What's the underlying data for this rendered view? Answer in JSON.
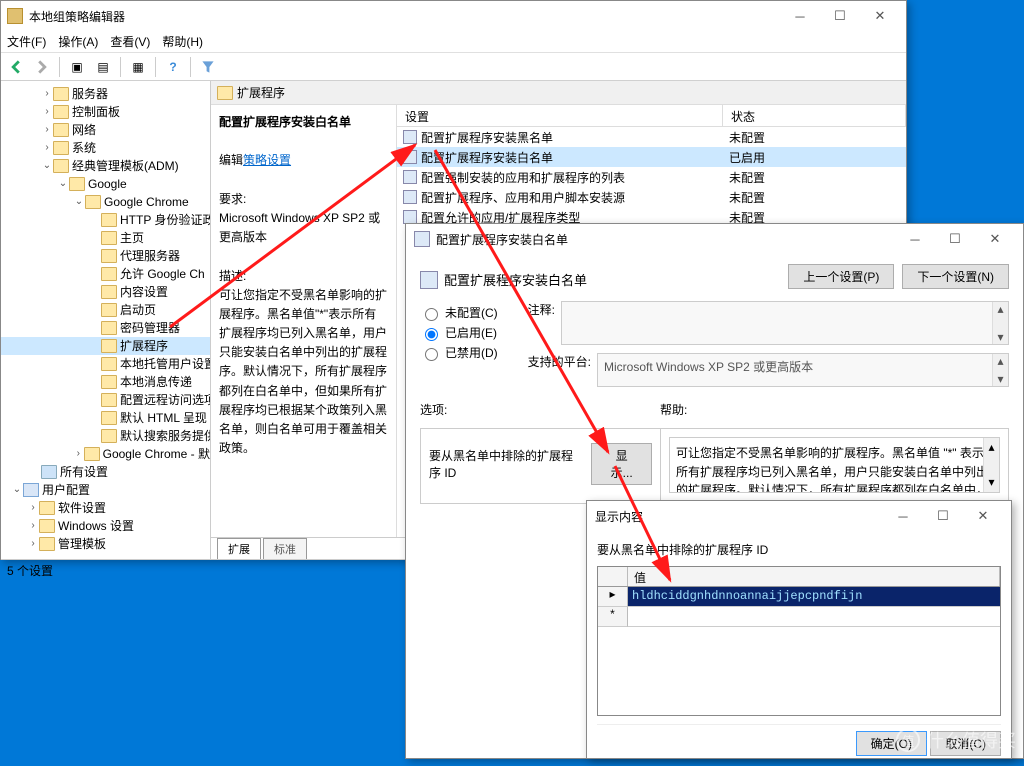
{
  "gpedit": {
    "title": "本地组策略编辑器",
    "menus": [
      "文件(F)",
      "操作(A)",
      "查看(V)",
      "帮助(H)"
    ],
    "tree": {
      "n0": "服务器",
      "n1": "控制面板",
      "n2": "网络",
      "n3": "系统",
      "n4": "经典管理模板(ADM)",
      "n5": "Google",
      "n6": "Google Chrome",
      "n7": "HTTP 身份验证政",
      "n8": "主页",
      "n9": "代理服务器",
      "n10": "允许 Google Ch",
      "n11": "内容设置",
      "n12": "启动页",
      "n13": "密码管理器",
      "n14": "扩展程序",
      "n15": "本地托管用户设置",
      "n16": "本地消息传递",
      "n17": "配置远程访问选项",
      "n18": "默认 HTML 呈现",
      "n19": "默认搜索服务提供",
      "n20": "Google Chrome - 默",
      "n21": "所有设置",
      "n22": "用户配置",
      "n23": "软件设置",
      "n24": "Windows 设置",
      "n25": "管理模板"
    },
    "status": "5 个设置",
    "right": {
      "header": "扩展程序",
      "bold_line": "配置扩展程序安装白名单",
      "edit_label": "编辑",
      "edit_link": "策略设置",
      "req_label": "要求:",
      "req_text": "Microsoft Windows XP SP2 或更高版本",
      "desc_label": "描述:",
      "desc_text": "可让您指定不受黑名单影响的扩展程序。黑名单值\"*\"表示所有扩展程序均已列入黑名单，用户只能安装白名单中列出的扩展程序。默认情况下，所有扩展程序都列在白名单中，但如果所有扩展程序均已根据某个政策列入黑名单，则白名单可用于覆盖相关政策。",
      "col_setting": "设置",
      "col_state": "状态",
      "rows": [
        {
          "name": "配置扩展程序安装黑名单",
          "state": "未配置"
        },
        {
          "name": "配置扩展程序安装白名单",
          "state": "已启用"
        },
        {
          "name": "配置强制安装的应用和扩展程序的列表",
          "state": "未配置"
        },
        {
          "name": "配置扩展程序、应用和用户脚本安装源",
          "state": "未配置"
        },
        {
          "name": "配置允许的应用/扩展程序类型",
          "state": "未配置"
        }
      ],
      "tab1": "扩展",
      "tab2": "标准"
    }
  },
  "dlg1": {
    "title": "配置扩展程序安装白名单",
    "heading": "配置扩展程序安装白名单",
    "prev": "上一个设置(P)",
    "next": "下一个设置(N)",
    "radio_nc": "未配置(C)",
    "radio_en": "已启用(E)",
    "radio_di": "已禁用(D)",
    "comment": "注释:",
    "support_label": "支持的平台:",
    "support_text": "Microsoft Windows XP SP2 或更高版本",
    "options": "选项:",
    "help": "帮助:",
    "opt_label": "要从黑名单中排除的扩展程序 ID",
    "btn_show": "显示...",
    "help_text": "可让您指定不受黑名单影响的扩展程序。黑名单值 \"*\" 表示所有扩展程序均已列入黑名单，用户只能安装白名单中列出的扩展程序。默认情况下，所有扩展程序都列在白名单中，但如果所有扩展程序均已根据某个政策列入黑名单，则白名单可用于覆盖相关政策。"
  },
  "dlg2": {
    "title": "显示内容",
    "caption": "要从黑名单中排除的扩展程序 ID",
    "col": "值",
    "value": "hldhciddgnhdnnoannaijjepcpndfijn",
    "ok": "确定(O)",
    "cancel": "取消(C)"
  },
  "watermark": "什么值得买"
}
